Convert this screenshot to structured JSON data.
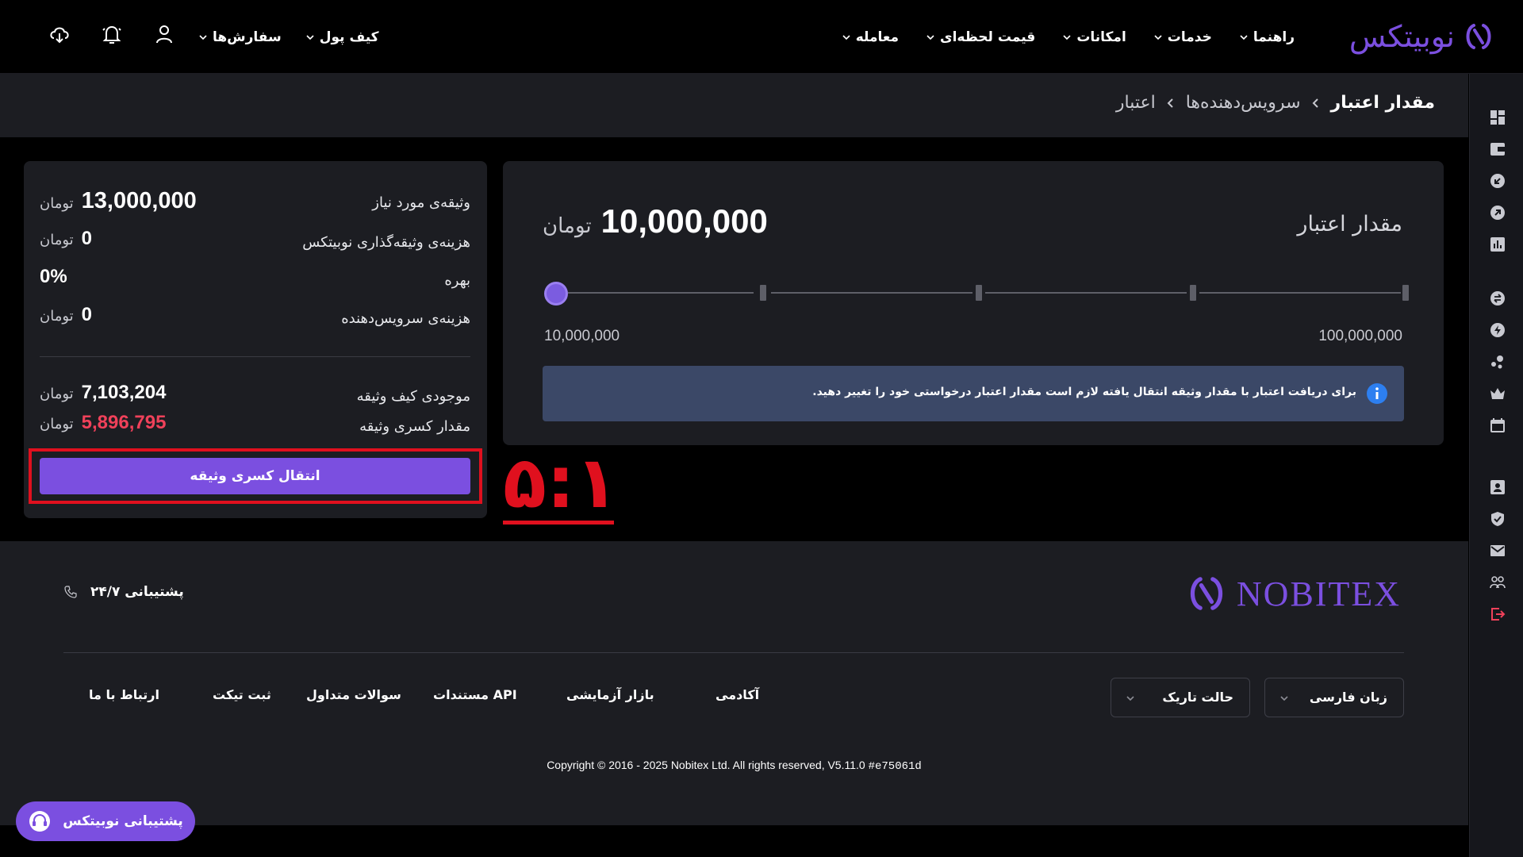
{
  "brand": {
    "name": "نوبیتکس",
    "accent": "#7b4fe0"
  },
  "nav": {
    "items": [
      {
        "label": "معامله"
      },
      {
        "label": "قیمت لحظه‌ای"
      },
      {
        "label": "امکانات"
      },
      {
        "label": "خدمات"
      },
      {
        "label": "راهنما"
      }
    ],
    "user_items": [
      {
        "label": "سفارش‌ها"
      },
      {
        "label": "کیف پول"
      }
    ],
    "tools": [
      "user-icon",
      "bell-icon",
      "download-icon"
    ]
  },
  "breadcrumb": {
    "items": [
      "اعتبار",
      "سرویس‌دهنده‌ها",
      "مقدار اعتبار"
    ]
  },
  "credit": {
    "title": "مقدار اعتبار",
    "amount": "10,000,000",
    "currency": "تومان",
    "slider": {
      "min_label": "10,000,000",
      "max_label": "100,000,000",
      "value_fraction": 0
    },
    "info_text": "برای دریافت اعتبار با مقدار وثیقه انتقال یافته لازم است مقدار اعتبار درخواستی خود را تغییر دهید."
  },
  "summary": {
    "rows": [
      {
        "label": "وثیقه‌ی مورد نیاز",
        "value": "13,000,000",
        "currency": "تومان"
      },
      {
        "label": "هزینه‌ی وثیقه‌گذاری نوبیتکس",
        "value": "0",
        "currency": "تومان"
      },
      {
        "label": "بهره",
        "value": "0%",
        "currency": ""
      },
      {
        "label": "هزینه‌ی سرویس‌دهنده",
        "value": "0",
        "currency": "تومان"
      }
    ],
    "wallet": {
      "label": "موجودی کیف وثیقه",
      "value": "7,103,204",
      "currency": "تومان"
    },
    "shortfall": {
      "label": "مقدار کسری وثیقه",
      "value": "5,896,795",
      "currency": "تومان",
      "color": "#f0415a"
    },
    "button_label": "انتقال کسری وثیقه"
  },
  "annotation": {
    "text": "۵:۱",
    "color": "#e0101e"
  },
  "footer": {
    "logo_word": "NOBITEX",
    "support_label": "پشتیبانی ۲۴/۷",
    "links": [
      "آکادمی",
      "بازار آزمایشی",
      "مستندات API",
      "سوالات متداول",
      "ثبت تیکت",
      "ارتباط با ما"
    ],
    "language": "زبان فارسی",
    "theme": "حالت تاریک",
    "copyright": "Copyright © 2016 - 2025 Nobitex Ltd. All rights reserved, V5.11.0",
    "version_hash": "#e75061d"
  },
  "support_pill": {
    "label": "پشتیبانی نوبیتکس"
  }
}
